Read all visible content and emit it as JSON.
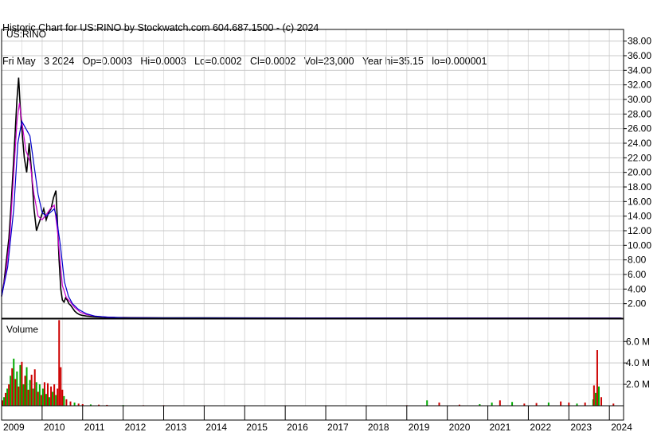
{
  "header": {
    "line1": "Historic Chart for US:RINO by Stockwatch.com 604.687.1500 - (c) 2024",
    "line2": "Fri May   3 2024   Op=0.0003   Hi=0.0003   Lo=0.0002   Cl=0.0002   Vol=23,000   Year hi=35.15   lo=0.000001"
  },
  "chart_data": [
    {
      "type": "line",
      "title": "US:RINO",
      "y_ticks": [
        "2.00",
        "4.00",
        "6.00",
        "8.00",
        "10.00",
        "12.00",
        "14.00",
        "16.00",
        "18.00",
        "20.00",
        "22.00",
        "24.00",
        "26.00",
        "28.00",
        "30.00",
        "32.00",
        "34.00",
        "36.00",
        "38.00"
      ],
      "ylim": [
        0,
        39.6
      ],
      "xlim": [
        2009.0,
        2024.35
      ],
      "grid": true,
      "series": [
        {
          "role": "price",
          "color": "#000000",
          "x": [
            2009.0,
            2009.06,
            2009.12,
            2009.18,
            2009.24,
            2009.3,
            2009.34,
            2009.38,
            2009.42,
            2009.46,
            2009.5,
            2009.56,
            2009.62,
            2009.68,
            2009.74,
            2009.8,
            2009.86,
            2009.92,
            2009.98,
            2010.04,
            2010.1,
            2010.16,
            2010.22,
            2010.28,
            2010.34,
            2010.38,
            2010.42,
            2010.46,
            2010.5,
            2010.54,
            2010.58,
            2010.62,
            2010.66,
            2010.7,
            2010.74,
            2010.8,
            2010.86,
            2010.92,
            2010.98,
            2011.1,
            2011.3,
            2011.5,
            2011.8,
            2012.2,
            2013,
            2015,
            2018,
            2021,
            2024.3
          ],
          "y": [
            3.0,
            5.0,
            8.0,
            11.0,
            16.0,
            22.0,
            26.0,
            30.0,
            33.0,
            29.0,
            26.0,
            22.0,
            20.0,
            24.0,
            20.0,
            15.0,
            12.0,
            13.0,
            14.0,
            15.0,
            13.5,
            14.5,
            15.0,
            16.5,
            17.5,
            13.0,
            8.0,
            4.0,
            2.5,
            2.2,
            2.8,
            2.5,
            2.0,
            1.8,
            1.5,
            1.0,
            0.7,
            0.5,
            0.4,
            0.3,
            0.2,
            0.15,
            0.1,
            0.08,
            0.05,
            0.03,
            0.02,
            0.01,
            0.0002
          ]
        },
        {
          "role": "moving-average-short",
          "color": "#cc00cc",
          "x": [
            2009.0,
            2009.1,
            2009.2,
            2009.3,
            2009.38,
            2009.44,
            2009.5,
            2009.6,
            2009.7,
            2009.8,
            2009.9,
            2010.0,
            2010.1,
            2010.2,
            2010.3,
            2010.38,
            2010.44,
            2010.5,
            2010.6,
            2010.7,
            2010.8,
            2010.95,
            2011.1,
            2011.3,
            2011.6,
            2012,
            2013,
            2024.3
          ],
          "y": [
            3.0,
            6.0,
            11.0,
            20.0,
            27.0,
            29.5,
            27.0,
            23.0,
            21.5,
            17.0,
            14.0,
            13.5,
            14.2,
            15.0,
            15.5,
            12.0,
            8.0,
            4.5,
            2.8,
            2.2,
            1.5,
            0.8,
            0.5,
            0.3,
            0.15,
            0.08,
            0.04,
            0.01
          ]
        },
        {
          "role": "moving-average-long",
          "color": "#0000cc",
          "x": [
            2009.0,
            2009.15,
            2009.3,
            2009.4,
            2009.5,
            2009.6,
            2009.7,
            2009.8,
            2009.9,
            2010.0,
            2010.1,
            2010.2,
            2010.3,
            2010.35,
            2010.45,
            2010.55,
            2010.65,
            2010.75,
            2010.9,
            2011.1,
            2011.3,
            2011.6,
            2012,
            2013,
            2024.3
          ],
          "y": [
            3.0,
            7.0,
            15.0,
            24.0,
            27.0,
            26.0,
            25.0,
            21.0,
            17.0,
            14.5,
            14.0,
            14.5,
            15.0,
            14.0,
            10.0,
            5.0,
            3.0,
            2.0,
            1.2,
            0.6,
            0.3,
            0.15,
            0.08,
            0.04,
            0.01
          ]
        }
      ]
    },
    {
      "type": "bar",
      "title": "Volume",
      "y_ticks": [
        "2.0 M",
        "4.0 M",
        "6.0 M"
      ],
      "ylim": [
        0,
        8.1
      ],
      "x_ticks": [
        "2009",
        "2010",
        "2011",
        "2012",
        "2013",
        "2014",
        "2015",
        "2016",
        "2017",
        "2018",
        "2019",
        "2020",
        "2021",
        "2022",
        "2023",
        "2024"
      ],
      "x": [
        2009.02,
        2009.06,
        2009.1,
        2009.14,
        2009.18,
        2009.22,
        2009.26,
        2009.3,
        2009.34,
        2009.38,
        2009.42,
        2009.46,
        2009.5,
        2009.54,
        2009.58,
        2009.62,
        2009.66,
        2009.7,
        2009.74,
        2009.78,
        2009.82,
        2009.86,
        2009.9,
        2009.94,
        2009.98,
        2010.02,
        2010.06,
        2010.1,
        2010.14,
        2010.18,
        2010.22,
        2010.26,
        2010.3,
        2010.34,
        2010.38,
        2010.42,
        2010.46,
        2010.5,
        2010.54,
        2010.6,
        2010.7,
        2010.8,
        2010.9,
        2011.0,
        2011.2,
        2011.4,
        2011.6,
        2012.0,
        2012.5,
        2013.0,
        2014.0,
        2015.0,
        2016.0,
        2017.0,
        2018.0,
        2019.0,
        2019.5,
        2019.8,
        2020.3,
        2020.8,
        2021.1,
        2021.3,
        2021.6,
        2021.9,
        2022.2,
        2022.5,
        2022.8,
        2023.0,
        2023.2,
        2023.4,
        2023.6,
        2023.62,
        2023.66,
        2023.7,
        2023.74,
        2023.8,
        2024.1
      ],
      "values": [
        0.5,
        0.8,
        1.2,
        1.6,
        2.0,
        2.8,
        3.5,
        4.4,
        2.5,
        3.2,
        1.8,
        3.8,
        4.1,
        2.0,
        2.8,
        3.6,
        1.5,
        2.4,
        2.9,
        1.6,
        3.4,
        2.2,
        1.3,
        2.0,
        1.0,
        1.6,
        2.2,
        1.1,
        2.1,
        0.8,
        1.8,
        1.3,
        2.0,
        1.0,
        1.6,
        8.0,
        3.6,
        1.5,
        0.9,
        0.6,
        0.4,
        0.3,
        0.2,
        0.15,
        0.12,
        0.1,
        0.08,
        0.06,
        0.05,
        0.05,
        0.04,
        0.04,
        0.04,
        0.04,
        0.04,
        0.05,
        0.5,
        0.3,
        0.1,
        0.15,
        0.3,
        0.5,
        0.35,
        0.2,
        0.25,
        0.3,
        0.4,
        0.3,
        0.2,
        0.3,
        0.6,
        1.9,
        1.2,
        5.2,
        1.8,
        0.8,
        0.2
      ],
      "colors": [
        "#cc0000",
        "#00aa00",
        "#cc0000",
        "#00aa00",
        "#cc0000",
        "#00aa00",
        "#cc0000",
        "#00aa00",
        "#cc0000",
        "#00aa00",
        "#cc0000",
        "#00aa00",
        "#cc0000",
        "#00aa00",
        "#cc0000",
        "#00aa00",
        "#cc0000",
        "#00aa00",
        "#cc0000",
        "#00aa00",
        "#cc0000",
        "#00aa00",
        "#cc0000",
        "#00aa00",
        "#cc0000",
        "#00aa00",
        "#cc0000",
        "#00aa00",
        "#cc0000",
        "#00aa00",
        "#cc0000",
        "#00aa00",
        "#cc0000",
        "#00aa00",
        "#cc0000",
        "#cc0000",
        "#cc0000",
        "#cc0000",
        "#00aa00",
        "#cc0000",
        "#cc0000",
        "#00aa00",
        "#cc0000",
        "#cc0000",
        "#00aa00",
        "#cc0000",
        "#cc0000",
        "#00aa00",
        "#cc0000",
        "#cc0000",
        "#cc0000",
        "#cc0000",
        "#cc0000",
        "#cc0000",
        "#cc0000",
        "#cc0000",
        "#00aa00",
        "#cc0000",
        "#cc0000",
        "#00aa00",
        "#00aa00",
        "#cc0000",
        "#00aa00",
        "#cc0000",
        "#cc0000",
        "#00aa00",
        "#cc0000",
        "#cc0000",
        "#00aa00",
        "#cc0000",
        "#00aa00",
        "#cc0000",
        "#00aa00",
        "#cc0000",
        "#00aa00",
        "#cc0000",
        "#cc0000"
      ]
    }
  ]
}
